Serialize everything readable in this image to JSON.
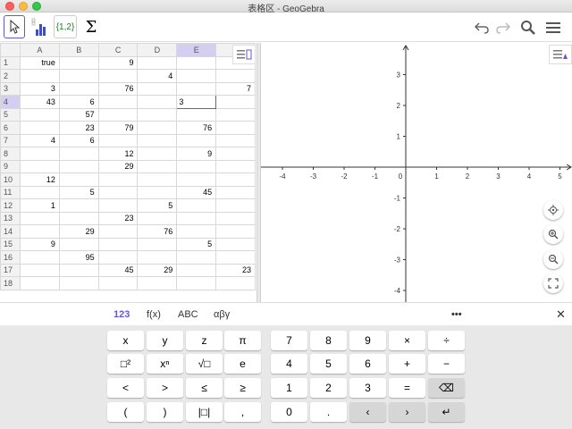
{
  "window": {
    "title": "表格区 - GeoGebra"
  },
  "toolbar": {
    "list_tool_label": "{1,2}",
    "sum_tool_label": "Σ",
    "icons": [
      "cursor-icon",
      "bar-chart-icon",
      "list-icon",
      "sigma-icon",
      "undo-icon",
      "redo-icon",
      "search-icon",
      "menu-icon"
    ]
  },
  "spreadsheet": {
    "columns": [
      "A",
      "B",
      "C",
      "D",
      "E"
    ],
    "active_cell": "E4",
    "active_cell_value": "3",
    "rows": [
      {
        "n": "1",
        "cells": [
          "true",
          "",
          "9",
          "",
          ""
        ],
        "f": ""
      },
      {
        "n": "2",
        "cells": [
          "",
          "",
          "",
          "4",
          ""
        ],
        "f": ""
      },
      {
        "n": "3",
        "cells": [
          "3",
          "",
          "76",
          "",
          ""
        ],
        "f": "7"
      },
      {
        "n": "4",
        "cells": [
          "43",
          "6",
          "",
          "",
          "3"
        ],
        "f": ""
      },
      {
        "n": "5",
        "cells": [
          "",
          "57",
          "",
          "",
          ""
        ],
        "f": ""
      },
      {
        "n": "6",
        "cells": [
          "",
          "23",
          "79",
          "",
          "76"
        ],
        "f": ""
      },
      {
        "n": "7",
        "cells": [
          "4",
          "6",
          "",
          "",
          ""
        ],
        "f": ""
      },
      {
        "n": "8",
        "cells": [
          "",
          "",
          "12",
          "",
          "9"
        ],
        "f": ""
      },
      {
        "n": "9",
        "cells": [
          "",
          "",
          "29",
          "",
          ""
        ],
        "f": ""
      },
      {
        "n": "10",
        "cells": [
          "12",
          "",
          "",
          "",
          ""
        ],
        "f": ""
      },
      {
        "n": "11",
        "cells": [
          "",
          "5",
          "",
          "",
          "45"
        ],
        "f": ""
      },
      {
        "n": "12",
        "cells": [
          "1",
          "",
          "",
          "5",
          ""
        ],
        "f": ""
      },
      {
        "n": "13",
        "cells": [
          "",
          "",
          "23",
          "",
          ""
        ],
        "f": ""
      },
      {
        "n": "14",
        "cells": [
          "",
          "29",
          "",
          "76",
          ""
        ],
        "f": ""
      },
      {
        "n": "15",
        "cells": [
          "9",
          "",
          "",
          "",
          "5"
        ],
        "f": ""
      },
      {
        "n": "16",
        "cells": [
          "",
          "95",
          "",
          "",
          ""
        ],
        "f": ""
      },
      {
        "n": "17",
        "cells": [
          "",
          "",
          "45",
          "29",
          ""
        ],
        "f": "23"
      },
      {
        "n": "18",
        "cells": [
          "",
          "",
          "",
          "",
          ""
        ],
        "f": ""
      }
    ]
  },
  "graphics": {
    "x_ticks": [
      "-4",
      "-3",
      "-2",
      "-1",
      "0",
      "1",
      "2",
      "3",
      "4",
      "5"
    ],
    "y_ticks_pos": [
      "3",
      "2",
      "1"
    ],
    "y_ticks_neg": [
      "-1",
      "-2",
      "-3",
      "-4"
    ],
    "buttons": [
      "home-icon",
      "zoom-in-icon",
      "zoom-out-icon",
      "fullscreen-icon"
    ]
  },
  "keyboard": {
    "tabs": [
      "123",
      "f(x)",
      "ABC",
      "αβγ"
    ],
    "active_tab": "123",
    "more": "•••",
    "close": "✕",
    "rows": [
      [
        "x",
        "y",
        "z",
        "π",
        "7",
        "8",
        "9",
        "×",
        "÷"
      ],
      [
        "□²",
        "xⁿ",
        "√□",
        "e",
        "4",
        "5",
        "6",
        "+",
        "−"
      ],
      [
        "<",
        ">",
        "≤",
        "≥",
        "1",
        "2",
        "3",
        "=",
        "⌫"
      ],
      [
        "(",
        ")",
        "|□|",
        ",",
        "0",
        ".",
        "‹",
        "›",
        "↵"
      ]
    ]
  }
}
